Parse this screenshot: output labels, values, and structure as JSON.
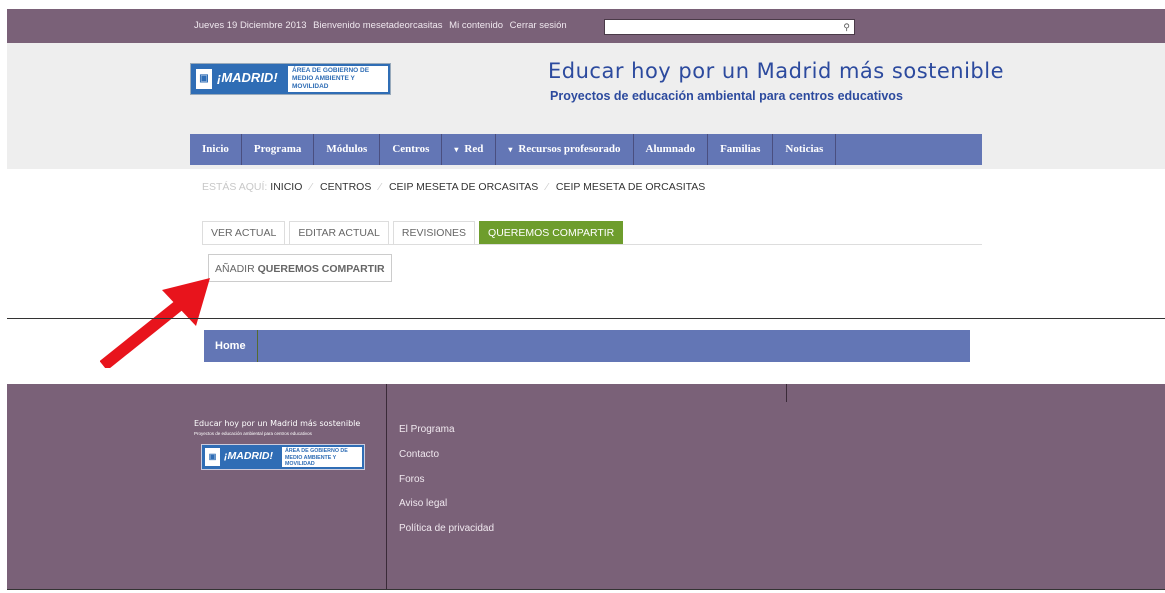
{
  "topbar": {
    "date": "Jueves 19 Diciembre 2013",
    "welcome": "Bienvenido mesetadeorcasitas",
    "my_content": "Mi contenido",
    "logout": "Cerrar sesión",
    "search_placeholder": "",
    "search_icon": "search-icon"
  },
  "header": {
    "logo_madrid": "¡MADRID!",
    "logo_area": "ÁREA DE GOBIERNO DE MEDIO AMBIENTE Y MOVILIDAD",
    "title": "Educar hoy por un Madrid más sostenible",
    "subtitle": "Proyectos de educación ambiental para centros educativos"
  },
  "nav": {
    "items": [
      {
        "label": "Inicio"
      },
      {
        "label": "Programa"
      },
      {
        "label": "Módulos"
      },
      {
        "label": "Centros"
      },
      {
        "label": "Red",
        "caret": "▾"
      },
      {
        "label": "Recursos profesorado",
        "caret": "▾"
      },
      {
        "label": "Alumnado"
      },
      {
        "label": "Familias"
      },
      {
        "label": "Noticias"
      }
    ]
  },
  "breadcrumb": {
    "prefix": "ESTÁS AQUÍ:",
    "items": [
      "INICIO",
      "CENTROS",
      "CEIP MESETA DE ORCASITAS",
      "CEIP MESETA DE ORCASITAS"
    ],
    "separator": "⁄"
  },
  "tabs": [
    {
      "label": "VER ACTUAL"
    },
    {
      "label": "EDITAR ACTUAL"
    },
    {
      "label": "REVISIONES"
    },
    {
      "label": "QUEREMOS COMPARTIR",
      "active": true
    }
  ],
  "add_button": {
    "prefix": "AÑADIR",
    "bold": "QUEREMOS COMPARTIR"
  },
  "home_nav": {
    "label": "Home"
  },
  "footer": {
    "logo_title": "Educar hoy por un Madrid más sostenible",
    "logo_sub": "Proyectos de educación ambiental para centros educativos",
    "logo_madrid": "¡MADRID!",
    "logo_area": "ÁREA DE GOBIERNO DE MEDIO AMBIENTE Y MOVILIDAD",
    "links": [
      "El Programa",
      "Contacto",
      "Foros",
      "Aviso legal",
      "Política de privacidad"
    ]
  },
  "colors": {
    "purple": "#7a6178",
    "nav_blue": "#6376b5",
    "active_green": "#6e9d2d",
    "arrow_red": "#e8141c",
    "title_blue": "#2c4a9e"
  }
}
